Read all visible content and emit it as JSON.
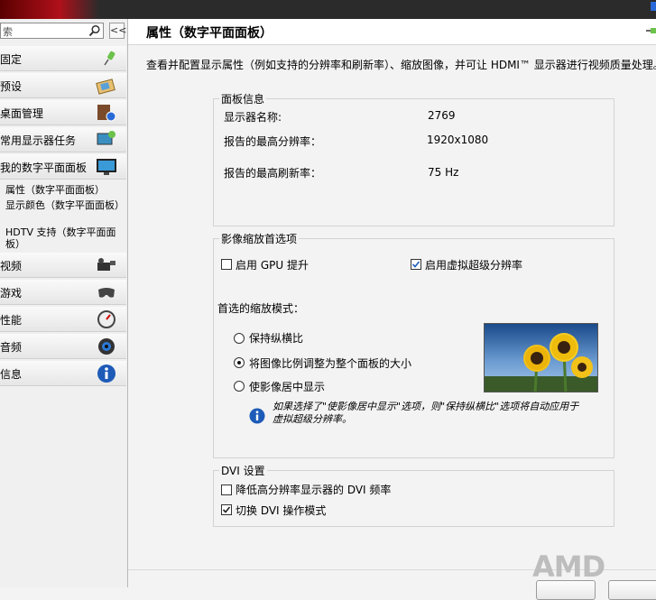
{
  "sidebar": {
    "search_placeholder": "索",
    "collapse_glyph": "<<",
    "items": [
      {
        "label": "固定",
        "icon": "pin-icon"
      },
      {
        "label": "预设",
        "icon": "presets-icon"
      },
      {
        "label": "桌面管理",
        "icon": "desktop-management-icon"
      },
      {
        "label": "常用显示器任务",
        "icon": "display-tasks-icon"
      },
      {
        "label": "我的数字平面面板",
        "icon": "flat-panel-icon"
      },
      {
        "label": "视频",
        "icon": "video-camera-icon"
      },
      {
        "label": "游戏",
        "icon": "gamepad-icon"
      },
      {
        "label": "性能",
        "icon": "gauge-icon"
      },
      {
        "label": "音频",
        "icon": "speaker-icon"
      },
      {
        "label": "信息",
        "icon": "info-icon"
      }
    ],
    "subitems": [
      "属性（数字平面面板）",
      "显示颜色（数字平面面板）",
      "HDTV 支持（数字平面面板）"
    ]
  },
  "main": {
    "title": "属性（数字平面面板）",
    "description": "查看并配置显示属性（例如支持的分辨率和刷新率）、缩放图像，并可让 HDMI™ 显示器进行视频质量处理。",
    "panel_info": {
      "legend": "面板信息",
      "rows": [
        {
          "label": "显示器名称:",
          "value": "2769"
        },
        {
          "label": "报告的最高分辨率：",
          "value": "1920x1080"
        },
        {
          "label": "报告的最高刷新率：",
          "value": "75 Hz"
        }
      ]
    },
    "scaling": {
      "legend": "影像缩放首选项",
      "gpu_scaling": {
        "label": "启用 GPU 提升",
        "checked": false
      },
      "vsr": {
        "label": "启用虚拟超级分辨率",
        "checked": true
      },
      "mode_label": "首选的缩放模式：",
      "modes": [
        {
          "label": "保持纵横比",
          "selected": false
        },
        {
          "label": "将图像比例调整为整个面板的大小",
          "selected": true
        },
        {
          "label": "使影像居中显示",
          "selected": false
        }
      ],
      "note": "如果选择了\"使影像居中显示\"选项，则\"保持纵横比\"选项将自动应用于虚拟超级分辨率。"
    },
    "dvi": {
      "legend": "DVI 设置",
      "reduce_freq": {
        "label": "降低高分辨率显示器的 DVI 频率",
        "checked": false
      },
      "switch_mode": {
        "label": "切换 DVI 操作模式",
        "checked": true
      }
    }
  },
  "footer": {
    "brand": "AMD"
  },
  "colors": {
    "accent_blue": "#1f5fbf",
    "info_icon_blue": "#1e5bb8",
    "sidebar_bg": "#f0f0f0"
  }
}
